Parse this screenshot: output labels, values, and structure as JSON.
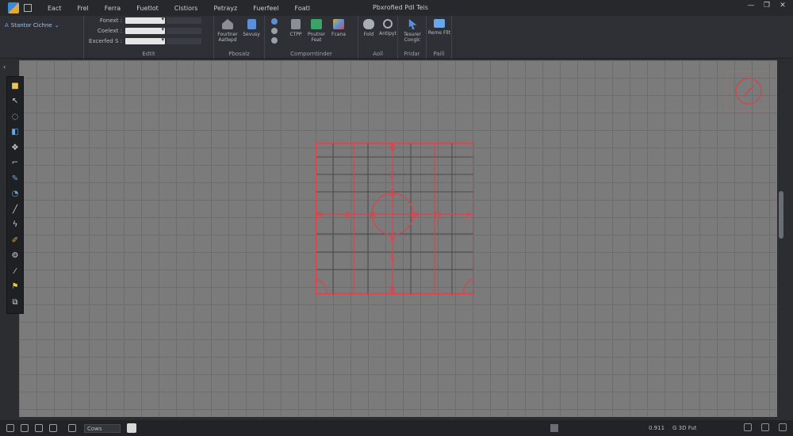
{
  "titlebar": {
    "menu": [
      "Eact",
      "Frel",
      "Ferra",
      "Fuetlot",
      "Clstiors",
      "Petrayz",
      "Fuerfeel",
      "Foatl"
    ],
    "doc_title": "Pbxrofied PdI Teis"
  },
  "ribbon": {
    "style_name": "Stantor Cichne",
    "fields": [
      {
        "label": "Fonext :"
      },
      {
        "label": "Coelext :"
      },
      {
        "label": "Excerfed S :"
      }
    ],
    "group_labels": {
      "edit": "Edtit",
      "annotate": "Pbosalz",
      "components": "Comporntinder",
      "add": "Aoll",
      "view": "Fridar",
      "draft": "Paill"
    },
    "buttons": {
      "format_a": "Fourtner Aatlepd",
      "format_b": "Sevusy",
      "ctpp": "CTPP",
      "pointer": "Pnutrer Feat",
      "forma": "Fcana",
      "fold": "Fold",
      "antipyt": "Antipyt",
      "tesurer": "Tesurer Conglc",
      "reme": "Reme Fllt"
    }
  },
  "drawing": {
    "row1": [
      "B",
      "F",
      "S"
    ],
    "row_mid": [
      "B",
      "A",
      "B",
      "B",
      "D",
      "E"
    ],
    "row_low": [
      "B",
      "S",
      "B"
    ]
  },
  "statusbar": {
    "view_select": "Cows",
    "coords": "0.911",
    "grid": "G 3D Fut"
  },
  "colors": {
    "accent_red": "#e0404a",
    "canvas": "#7b7b7b"
  }
}
